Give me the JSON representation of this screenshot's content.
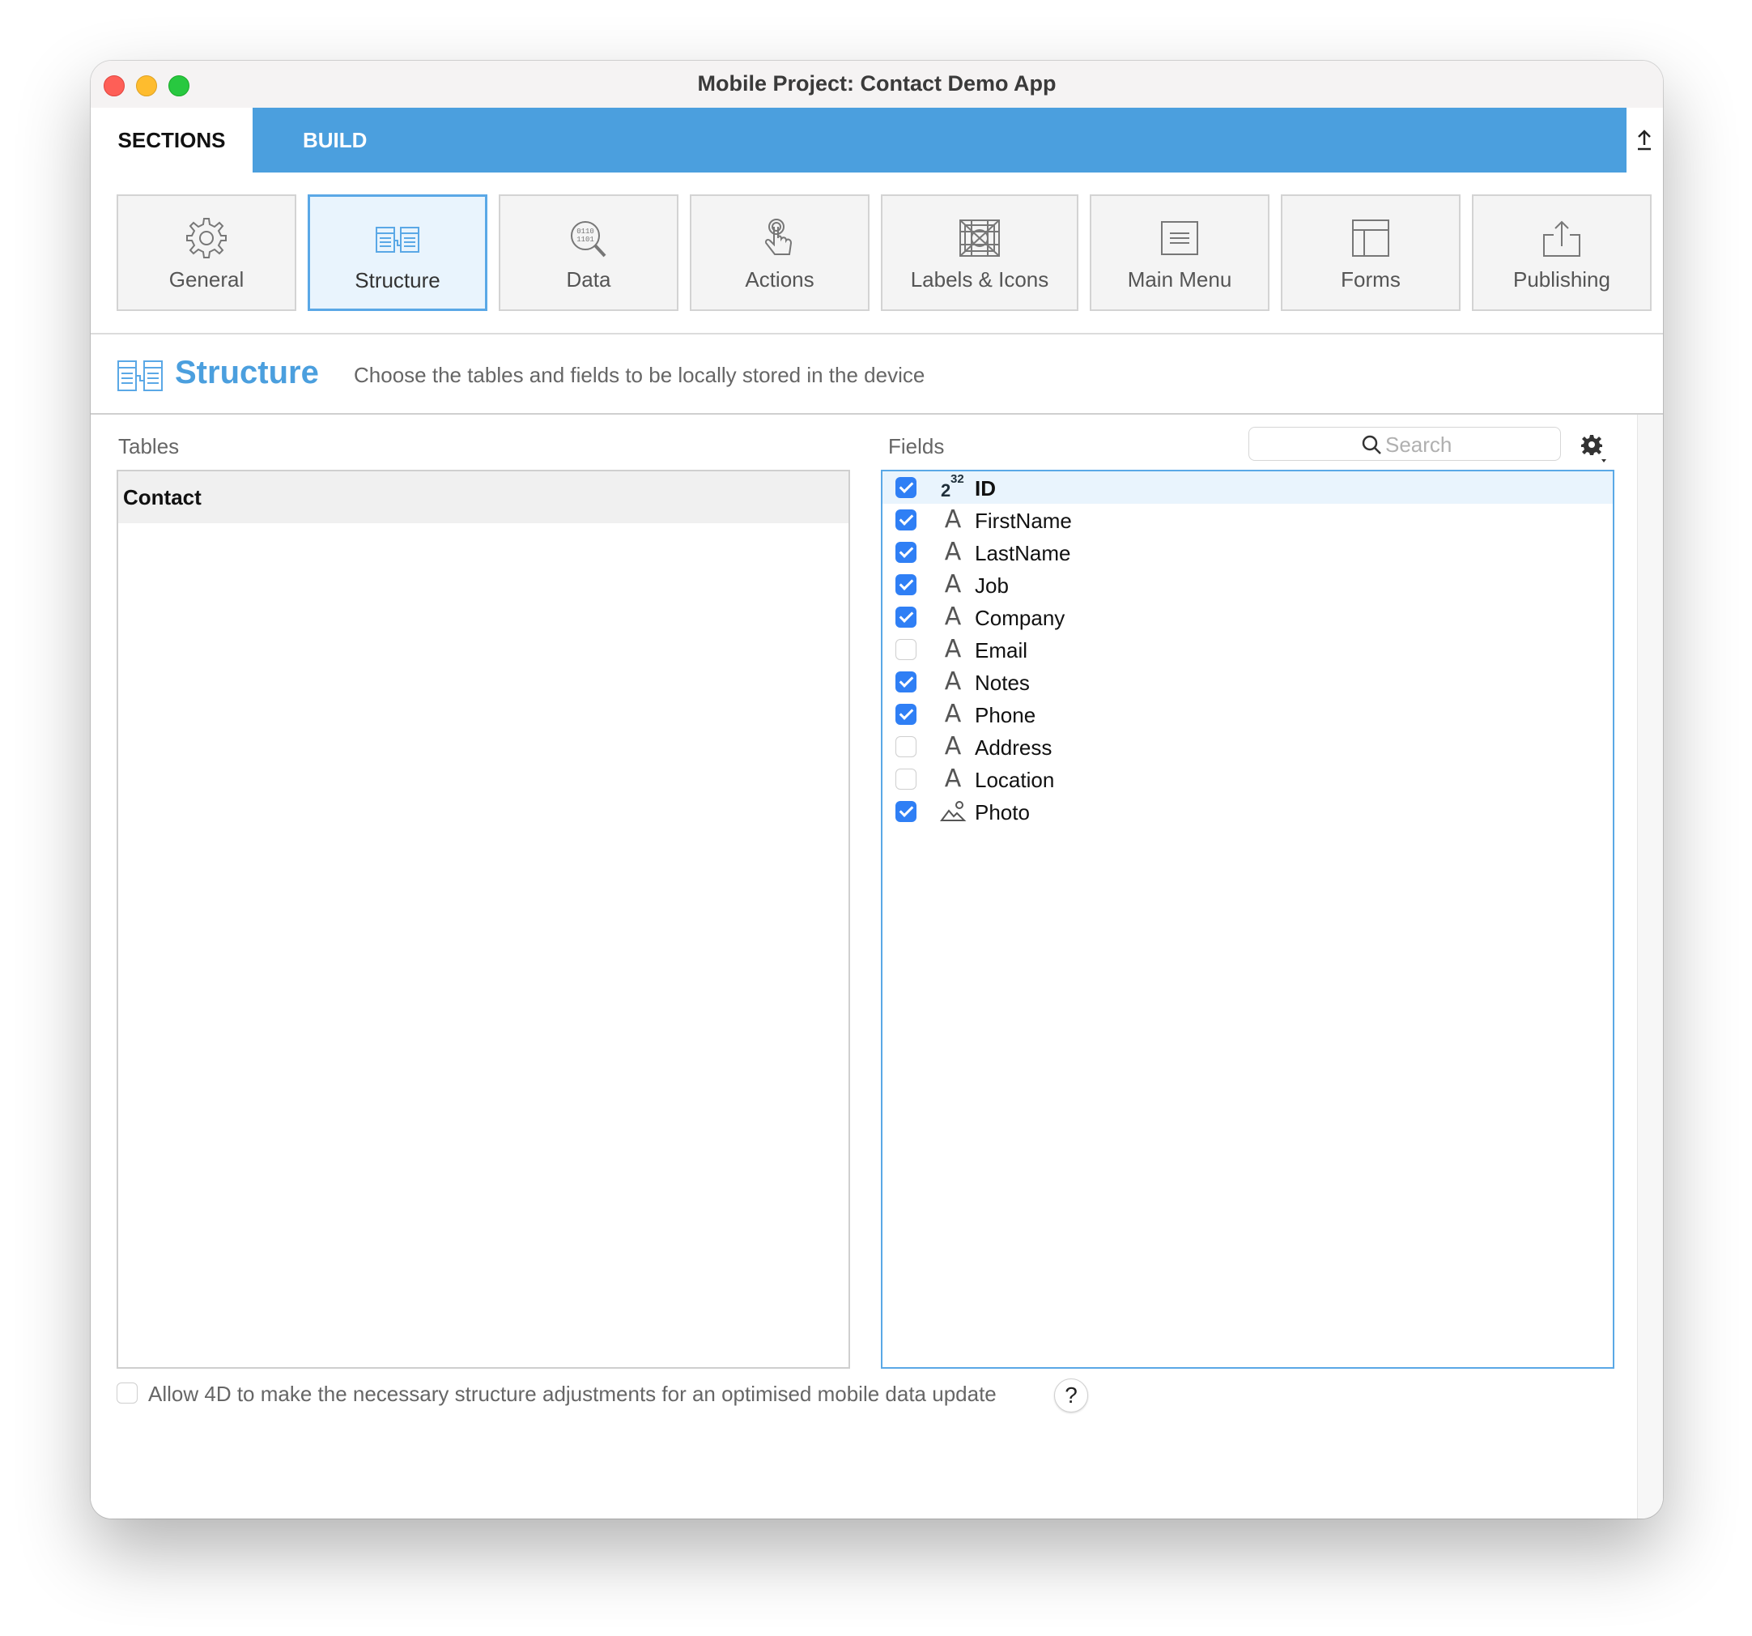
{
  "window": {
    "title": "Mobile Project: Contact Demo App"
  },
  "tabs": {
    "sections": "SECTIONS",
    "build": "BUILD"
  },
  "sections": [
    {
      "label": "General",
      "icon": "gear-icon"
    },
    {
      "label": "Structure",
      "icon": "structure-icon",
      "active": true
    },
    {
      "label": "Data",
      "icon": "data-icon"
    },
    {
      "label": "Actions",
      "icon": "touch-icon"
    },
    {
      "label": "Labels & Icons",
      "icon": "labels-icons-icon"
    },
    {
      "label": "Main Menu",
      "icon": "menu-icon"
    },
    {
      "label": "Forms",
      "icon": "forms-icon"
    },
    {
      "label": "Publishing",
      "icon": "publish-icon"
    }
  ],
  "structure": {
    "title": "Structure",
    "description": "Choose the tables and fields to be locally stored in the device"
  },
  "tables": {
    "label": "Tables",
    "items": [
      {
        "name": "Contact",
        "selected": true
      }
    ]
  },
  "fields": {
    "label": "Fields",
    "search_placeholder": "Search",
    "items": [
      {
        "name": "ID",
        "type": "number",
        "checked": true,
        "selected": true
      },
      {
        "name": "FirstName",
        "type": "text",
        "checked": true
      },
      {
        "name": "LastName",
        "type": "text",
        "checked": true
      },
      {
        "name": "Job",
        "type": "text",
        "checked": true
      },
      {
        "name": "Company",
        "type": "text",
        "checked": true
      },
      {
        "name": "Email",
        "type": "text",
        "checked": false
      },
      {
        "name": "Notes",
        "type": "text",
        "checked": true
      },
      {
        "name": "Phone",
        "type": "text",
        "checked": true
      },
      {
        "name": "Address",
        "type": "text",
        "checked": false
      },
      {
        "name": "Location",
        "type": "text",
        "checked": false
      },
      {
        "name": "Photo",
        "type": "picture",
        "checked": true
      }
    ],
    "type_glyphs": {
      "text": "A",
      "number_base": "2",
      "number_exp": "32"
    }
  },
  "option": {
    "label": "Allow 4D to make the necessary structure adjustments for an optimised mobile data update",
    "checked": false,
    "help": "?"
  },
  "colors": {
    "accent": "#4b9fde",
    "checkbox": "#2f7ff5"
  }
}
